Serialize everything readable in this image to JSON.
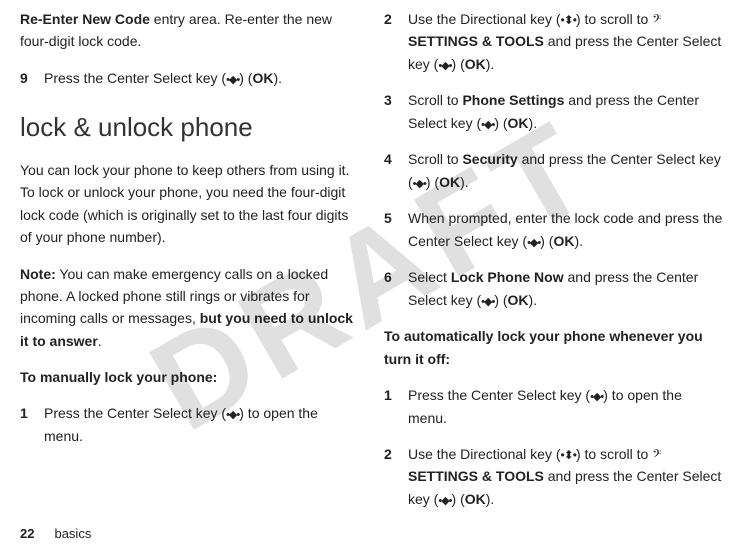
{
  "watermark": "DRAFT",
  "left": {
    "opening_fragment_prefix_bold": "Re-Enter New Code",
    "opening_fragment_rest": " entry area. Re-enter the new four-digit lock code.",
    "step9_num": "9",
    "step9_text_a": "Press the Center Select key (",
    "step9_icon": "•◆•",
    "step9_text_b": ") (",
    "step9_ok": "OK",
    "step9_text_c": ").",
    "heading": "lock & unlock phone",
    "para1": "You can lock your phone to keep others from using it. To lock or unlock your phone, you need the four-digit lock code (which is originally set to the last four digits of your phone number).",
    "note_label": "Note:",
    "note_body_a": " You can make emergency calls on a locked phone. A locked phone still rings or vibrates for incoming calls or messages, ",
    "note_bold": "but you need to unlock it to answer",
    "note_body_b": ".",
    "subhead1": "To manually lock your phone:",
    "step1_num": "1",
    "step1_text_a": "Press the Center Select key (",
    "step1_icon": "•◆•",
    "step1_text_b": ") to open the menu."
  },
  "right": {
    "step2_num": "2",
    "step2_text_a": "Use the Directional key (",
    "step2_icon": "•⬍•",
    "step2_text_b": ") to scroll to ",
    "step2_tool": "𝄢",
    "step2_bold": " SETTINGS & TOOLS",
    "step2_text_c": " and press the Center Select key (",
    "step2_icon2": "•◆•",
    "step2_text_d": ") (",
    "step2_ok": "OK",
    "step2_text_e": ").",
    "step3_num": "3",
    "step3_text_a": "Scroll to ",
    "step3_bold": "Phone Settings",
    "step3_text_b": " and press the Center Select key (",
    "step3_icon": "•◆•",
    "step3_text_c": ") (",
    "step3_ok": "OK",
    "step3_text_d": ").",
    "step4_num": "4",
    "step4_text_a": "Scroll to ",
    "step4_bold": "Security",
    "step4_text_b": " and press the Center Select key (",
    "step4_icon": "•◆•",
    "step4_text_c": ") (",
    "step4_ok": "OK",
    "step4_text_d": ").",
    "step5_num": "5",
    "step5_text_a": "When prompted, enter the lock code and press the Center Select key (",
    "step5_icon": "•◆•",
    "step5_text_b": ") (",
    "step5_ok": "OK",
    "step5_text_c": ").",
    "step6_num": "6",
    "step6_text_a": "Select ",
    "step6_bold": "Lock Phone Now",
    "step6_text_b": " and press the Center Select key (",
    "step6_icon": "•◆•",
    "step6_text_c": ") (",
    "step6_ok": "OK",
    "step6_text_d": ").",
    "subhead2": "To automatically lock your phone whenever you turn it off:",
    "b_step1_num": "1",
    "b_step1_text_a": "Press the Center Select key (",
    "b_step1_icon": "•◆•",
    "b_step1_text_b": ") to open the menu.",
    "b_step2_num": "2",
    "b_step2_text_a": "Use the Directional key (",
    "b_step2_icon": "•⬍•",
    "b_step2_text_b": ") to scroll to ",
    "b_step2_tool": "𝄢",
    "b_step2_bold": " SETTINGS & TOOLS",
    "b_step2_text_c": " and press the Center Select key (",
    "b_step2_icon2": "•◆•",
    "b_step2_text_d": ") (",
    "b_step2_ok": "OK",
    "b_step2_text_e": ")."
  },
  "footer": {
    "page": "22",
    "section": "basics"
  }
}
